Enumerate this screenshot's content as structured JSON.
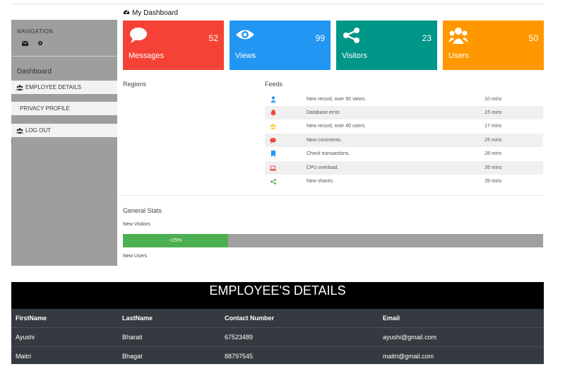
{
  "header": {
    "title": "My Dashboard"
  },
  "sidebar": {
    "nav_title": "NAVIGATION",
    "section": "Dashboard",
    "items": [
      {
        "label": "EMPLOYEE DETAILS",
        "icon": "users-icon"
      },
      {
        "label": "PRIVACY PROFILE"
      },
      {
        "label": "LOG OUT",
        "icon": "users-icon"
      }
    ]
  },
  "cards": [
    {
      "label": "Messages",
      "value": "52",
      "color": "#f44336",
      "icon": "chat-bubble-icon"
    },
    {
      "label": "Views",
      "value": "99",
      "color": "#2196f3",
      "icon": "eye-icon"
    },
    {
      "label": "Visitors",
      "value": "23",
      "color": "#009688",
      "icon": "share-icon"
    },
    {
      "label": "Users",
      "value": "50",
      "color": "#ff9800",
      "icon": "users-icon"
    }
  ],
  "regions": {
    "label": "Regions"
  },
  "feeds": {
    "label": "Feeds",
    "items": [
      {
        "text": "New record, over 90 views.",
        "time": "10 mins",
        "icon": "user-icon",
        "color": "#2196f3"
      },
      {
        "text": "Database error.",
        "time": "15 mins",
        "icon": "bell-icon",
        "color": "#f44336"
      },
      {
        "text": "New record, over 40 users.",
        "time": "17 mins",
        "icon": "users-icon",
        "color": "#ffc107"
      },
      {
        "text": "New comments.",
        "time": "25 mins",
        "icon": "comment-icon",
        "color": "#f44336"
      },
      {
        "text": "Check transactions.",
        "time": "28 mins",
        "icon": "bookmark-icon",
        "color": "#2196f3"
      },
      {
        "text": "CPU overload.",
        "time": "35 mins",
        "icon": "laptop-icon",
        "color": "#f44336"
      },
      {
        "text": "New shares.",
        "time": "39 mins",
        "icon": "share-icon",
        "color": "#4caf50"
      }
    ]
  },
  "stats": {
    "title": "General Stats",
    "new_visitors_label": "New Visitors",
    "new_visitors_text": "+25%",
    "new_visitors_value": 0.25,
    "new_users_label": "New Users"
  },
  "employees": {
    "title": "EMPLOYEE'S DETAILS",
    "columns": [
      "FirstName",
      "LastName",
      "Contact Number",
      "Email"
    ],
    "rows": [
      [
        "Ayushi",
        "Bharati",
        "67523489",
        "ayushi@gmail.com"
      ],
      [
        "Maitri",
        "Bhagat",
        "88797545",
        "maitri@gmail.com"
      ]
    ]
  }
}
